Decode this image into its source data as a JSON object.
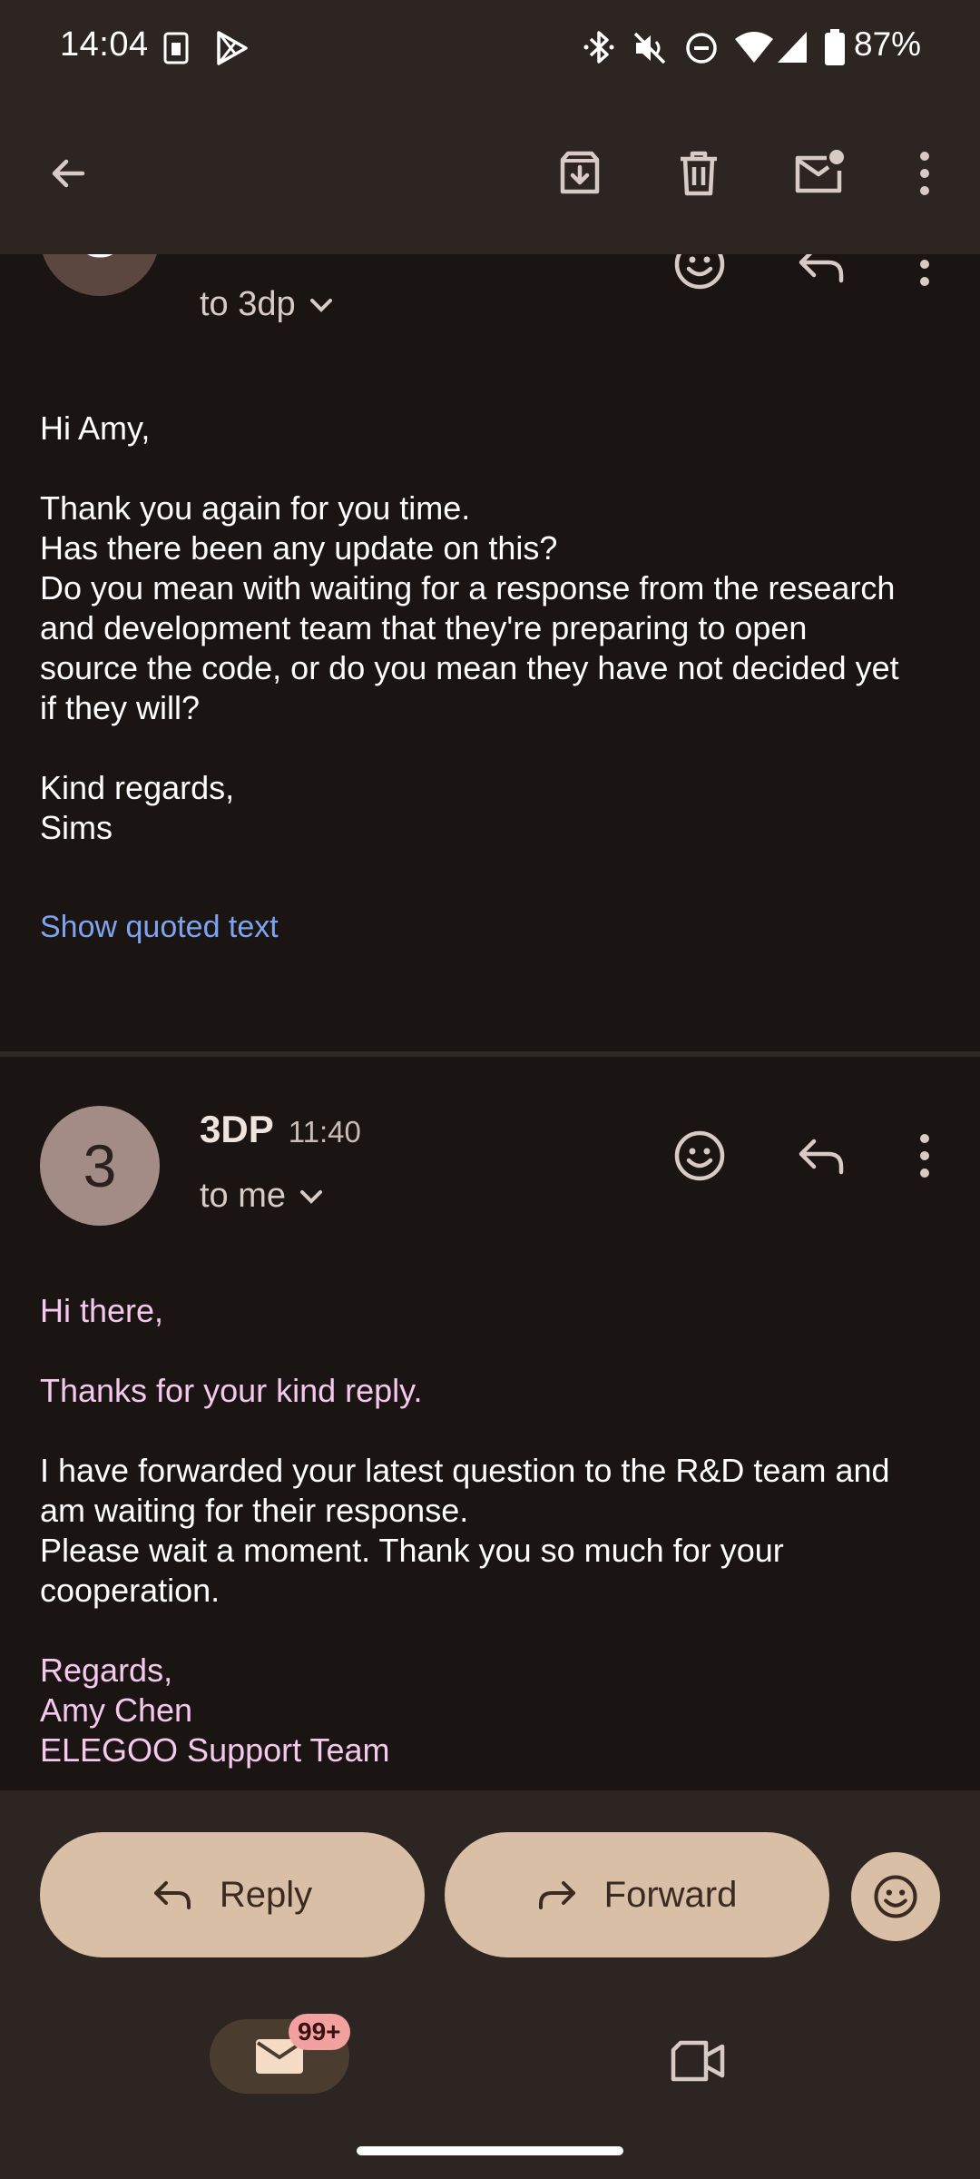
{
  "status_bar": {
    "time": "14:04",
    "battery": "87%",
    "icons": [
      "sim-card-icon",
      "play-store-icon",
      "bluetooth-icon",
      "mute-icon",
      "do-not-disturb-icon",
      "wifi-icon",
      "signal-icon",
      "battery-icon"
    ]
  },
  "toolbar": {
    "icons": [
      "back-arrow-icon",
      "archive-icon",
      "delete-icon",
      "mark-unread-icon",
      "more-vert-icon"
    ]
  },
  "message1": {
    "avatar_letter": "S",
    "recipient": "to 3dp",
    "body": {
      "greeting": "Hi Amy,",
      "lines": [
        "Thank you again for you time.",
        "Has there been any update on this?",
        "Do you mean with waiting for a response from the research",
        "and development team that they're preparing to open",
        "source the code, or do you mean they have not decided yet",
        "if they will?"
      ],
      "signoff": "Kind regards,",
      "signature": "Sims"
    },
    "show_quoted": "Show quoted text"
  },
  "message2": {
    "avatar_letter": "3",
    "sender": "3DP",
    "time": "11:40",
    "recipient": "to me",
    "body": {
      "greeting": "Hi there,",
      "thanks": "Thanks for your kind reply.",
      "lines": [
        "I have forwarded your latest question to the R&D team and",
        "am waiting for their response.",
        "Please wait a moment. Thank you so much for your",
        "cooperation."
      ],
      "signoff": "Regards,",
      "name": "Amy Chen",
      "team": "ELEGOO Support Team"
    }
  },
  "actions": {
    "reply": "Reply",
    "forward": "Forward"
  },
  "bottom_nav": {
    "mail_badge": "99+"
  },
  "colors": {
    "background": "#1a1412",
    "bar": "#2c2521",
    "pill": "#d9bfa6",
    "link": "#7ea4f0",
    "quoted_pink": "#f5c8ee",
    "badge": "#f3a0a0"
  }
}
